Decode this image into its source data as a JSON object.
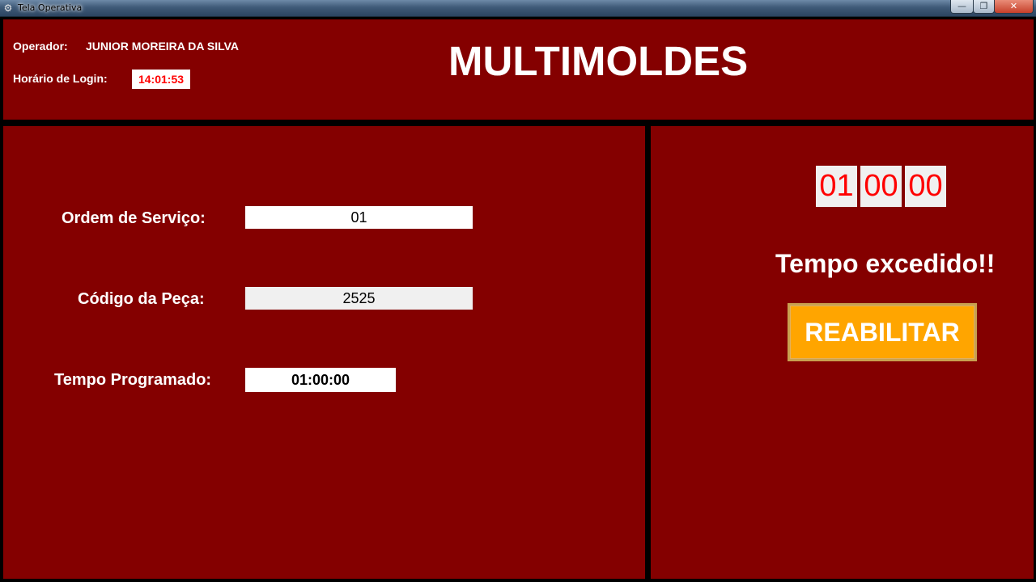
{
  "window": {
    "title": "Tela Operativa",
    "app_icon": "gear-icon",
    "controls": {
      "minimize_icon": "minimize-icon",
      "maximize_icon": "maximize-icon",
      "close_icon": "close-icon",
      "minimize_glyph": "—",
      "maximize_glyph": "❐",
      "close_glyph": "✕"
    }
  },
  "header": {
    "operator_label": "Operador:",
    "operator_name": "JUNIOR MOREIRA DA SILVA",
    "login_label": "Horário de Login:",
    "login_time": "14:01:53",
    "brand": "MULTIMOLDES"
  },
  "form": {
    "service_order_label": "Ordem de Serviço:",
    "service_order_value": "01",
    "part_code_label": "Código da Peça:",
    "part_code_value": "2525",
    "programmed_time_label": "Tempo Programado:",
    "programmed_time_value": "01:00:00"
  },
  "timer": {
    "hours": "01",
    "minutes": "00",
    "seconds": "00",
    "status": "Tempo excedido!!",
    "reenable_button": "REABILITAR"
  },
  "colors": {
    "panel_background": "#840000",
    "frame": "#000000",
    "timer_text": "#ff0000",
    "login_time_text": "#ff0000",
    "button_background": "#ffa500"
  }
}
